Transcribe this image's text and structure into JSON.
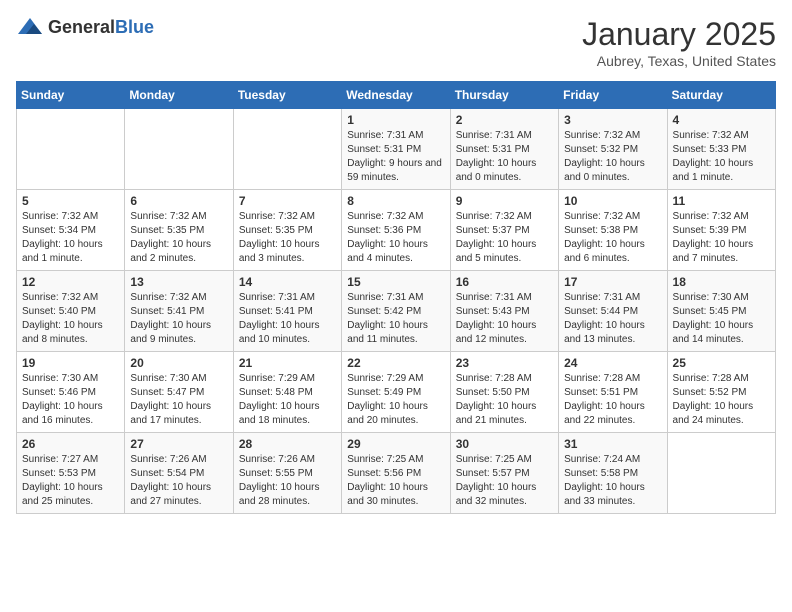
{
  "header": {
    "logo_general": "General",
    "logo_blue": "Blue",
    "title": "January 2025",
    "subtitle": "Aubrey, Texas, United States"
  },
  "days_of_week": [
    "Sunday",
    "Monday",
    "Tuesday",
    "Wednesday",
    "Thursday",
    "Friday",
    "Saturday"
  ],
  "weeks": [
    [
      {
        "day": "",
        "info": ""
      },
      {
        "day": "",
        "info": ""
      },
      {
        "day": "",
        "info": ""
      },
      {
        "day": "1",
        "info": "Sunrise: 7:31 AM\nSunset: 5:31 PM\nDaylight: 9 hours and 59 minutes."
      },
      {
        "day": "2",
        "info": "Sunrise: 7:31 AM\nSunset: 5:31 PM\nDaylight: 10 hours and 0 minutes."
      },
      {
        "day": "3",
        "info": "Sunrise: 7:32 AM\nSunset: 5:32 PM\nDaylight: 10 hours and 0 minutes."
      },
      {
        "day": "4",
        "info": "Sunrise: 7:32 AM\nSunset: 5:33 PM\nDaylight: 10 hours and 1 minute."
      }
    ],
    [
      {
        "day": "5",
        "info": "Sunrise: 7:32 AM\nSunset: 5:34 PM\nDaylight: 10 hours and 1 minute."
      },
      {
        "day": "6",
        "info": "Sunrise: 7:32 AM\nSunset: 5:35 PM\nDaylight: 10 hours and 2 minutes."
      },
      {
        "day": "7",
        "info": "Sunrise: 7:32 AM\nSunset: 5:35 PM\nDaylight: 10 hours and 3 minutes."
      },
      {
        "day": "8",
        "info": "Sunrise: 7:32 AM\nSunset: 5:36 PM\nDaylight: 10 hours and 4 minutes."
      },
      {
        "day": "9",
        "info": "Sunrise: 7:32 AM\nSunset: 5:37 PM\nDaylight: 10 hours and 5 minutes."
      },
      {
        "day": "10",
        "info": "Sunrise: 7:32 AM\nSunset: 5:38 PM\nDaylight: 10 hours and 6 minutes."
      },
      {
        "day": "11",
        "info": "Sunrise: 7:32 AM\nSunset: 5:39 PM\nDaylight: 10 hours and 7 minutes."
      }
    ],
    [
      {
        "day": "12",
        "info": "Sunrise: 7:32 AM\nSunset: 5:40 PM\nDaylight: 10 hours and 8 minutes."
      },
      {
        "day": "13",
        "info": "Sunrise: 7:32 AM\nSunset: 5:41 PM\nDaylight: 10 hours and 9 minutes."
      },
      {
        "day": "14",
        "info": "Sunrise: 7:31 AM\nSunset: 5:41 PM\nDaylight: 10 hours and 10 minutes."
      },
      {
        "day": "15",
        "info": "Sunrise: 7:31 AM\nSunset: 5:42 PM\nDaylight: 10 hours and 11 minutes."
      },
      {
        "day": "16",
        "info": "Sunrise: 7:31 AM\nSunset: 5:43 PM\nDaylight: 10 hours and 12 minutes."
      },
      {
        "day": "17",
        "info": "Sunrise: 7:31 AM\nSunset: 5:44 PM\nDaylight: 10 hours and 13 minutes."
      },
      {
        "day": "18",
        "info": "Sunrise: 7:30 AM\nSunset: 5:45 PM\nDaylight: 10 hours and 14 minutes."
      }
    ],
    [
      {
        "day": "19",
        "info": "Sunrise: 7:30 AM\nSunset: 5:46 PM\nDaylight: 10 hours and 16 minutes."
      },
      {
        "day": "20",
        "info": "Sunrise: 7:30 AM\nSunset: 5:47 PM\nDaylight: 10 hours and 17 minutes."
      },
      {
        "day": "21",
        "info": "Sunrise: 7:29 AM\nSunset: 5:48 PM\nDaylight: 10 hours and 18 minutes."
      },
      {
        "day": "22",
        "info": "Sunrise: 7:29 AM\nSunset: 5:49 PM\nDaylight: 10 hours and 20 minutes."
      },
      {
        "day": "23",
        "info": "Sunrise: 7:28 AM\nSunset: 5:50 PM\nDaylight: 10 hours and 21 minutes."
      },
      {
        "day": "24",
        "info": "Sunrise: 7:28 AM\nSunset: 5:51 PM\nDaylight: 10 hours and 22 minutes."
      },
      {
        "day": "25",
        "info": "Sunrise: 7:28 AM\nSunset: 5:52 PM\nDaylight: 10 hours and 24 minutes."
      }
    ],
    [
      {
        "day": "26",
        "info": "Sunrise: 7:27 AM\nSunset: 5:53 PM\nDaylight: 10 hours and 25 minutes."
      },
      {
        "day": "27",
        "info": "Sunrise: 7:26 AM\nSunset: 5:54 PM\nDaylight: 10 hours and 27 minutes."
      },
      {
        "day": "28",
        "info": "Sunrise: 7:26 AM\nSunset: 5:55 PM\nDaylight: 10 hours and 28 minutes."
      },
      {
        "day": "29",
        "info": "Sunrise: 7:25 AM\nSunset: 5:56 PM\nDaylight: 10 hours and 30 minutes."
      },
      {
        "day": "30",
        "info": "Sunrise: 7:25 AM\nSunset: 5:57 PM\nDaylight: 10 hours and 32 minutes."
      },
      {
        "day": "31",
        "info": "Sunrise: 7:24 AM\nSunset: 5:58 PM\nDaylight: 10 hours and 33 minutes."
      },
      {
        "day": "",
        "info": ""
      }
    ]
  ]
}
